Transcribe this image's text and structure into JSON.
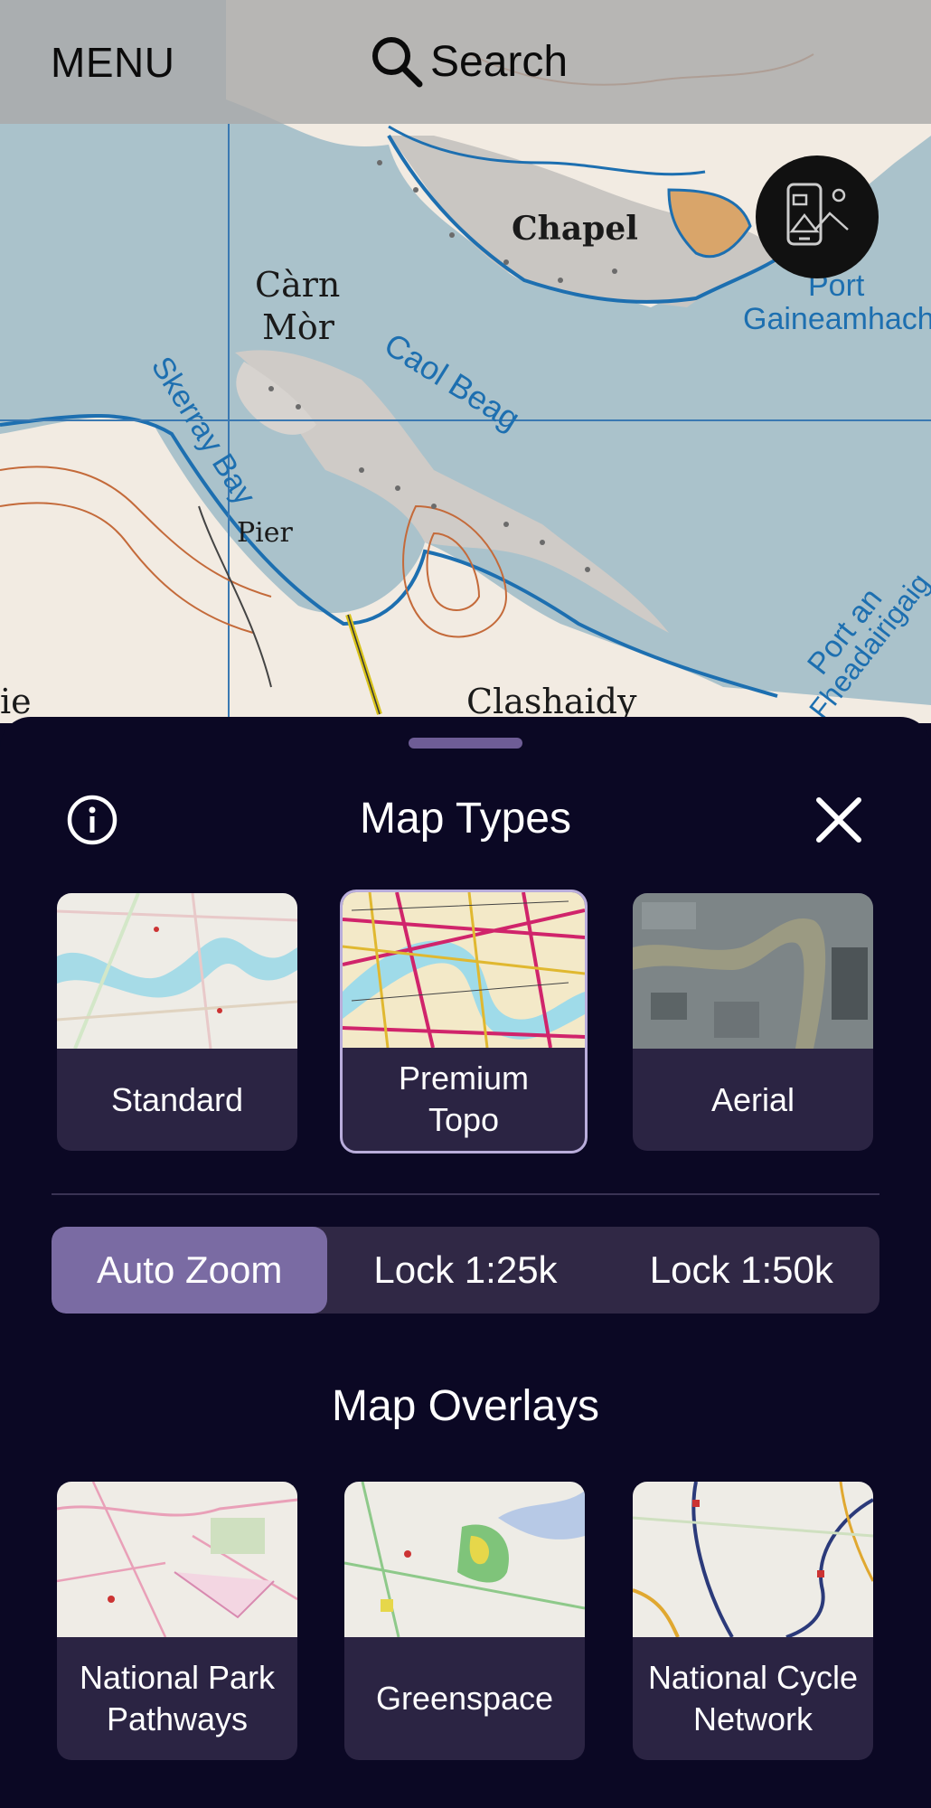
{
  "header": {
    "menu_label": "MENU",
    "search_label": "Search",
    "search_icon": "search-icon"
  },
  "map": {
    "labels": {
      "chapel": "Chapel",
      "carn": "Càrn",
      "mor": "Mòr",
      "caol_beag": "Caol Beag",
      "skerray_bay": "Skerray Bay",
      "pier": "Pier",
      "port": "Port",
      "gaineamhach": "Gaineamhach",
      "port_an": "Port an",
      "fheadairigaig": "Fheadairigaig",
      "clashaidy": "Clashaidy",
      "ie": "ie"
    },
    "layers_button_icon": "map-layers-icon"
  },
  "sheet": {
    "title": "Map Types",
    "info_icon": "info-icon",
    "close_icon": "close-icon",
    "map_types": [
      {
        "label": "Standard",
        "selected": false
      },
      {
        "label": "Premium\nTopo",
        "selected": true
      },
      {
        "label": "Aerial",
        "selected": false
      }
    ],
    "zoom_options": [
      {
        "label": "Auto Zoom",
        "selected": true
      },
      {
        "label": "Lock 1:25k",
        "selected": false
      },
      {
        "label": "Lock 1:50k",
        "selected": false
      }
    ],
    "overlays_title": "Map Overlays",
    "overlays": [
      {
        "label": "National Park\nPathways"
      },
      {
        "label": "Greenspace"
      },
      {
        "label": "National Cycle\nNetwork"
      }
    ]
  },
  "colors": {
    "sheet_background": "#0b0824",
    "card_background": "#2b2443",
    "segment_active": "#7a6ba3",
    "segment_background": "#302845",
    "selected_border": "#b9addb"
  }
}
